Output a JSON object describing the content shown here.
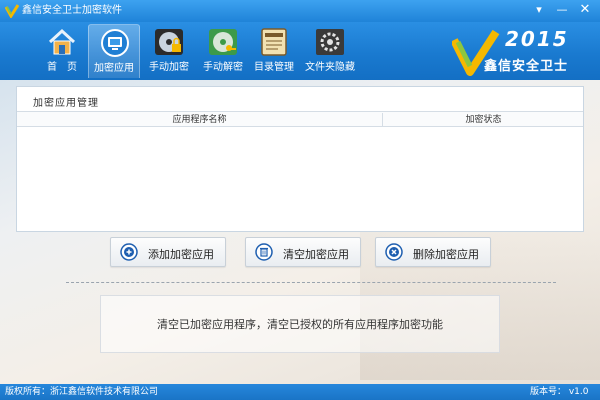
{
  "window": {
    "title": "鑫信安全卫士加密软件",
    "menu_glyph": "▾",
    "min_glyph": "—",
    "close_glyph": "✕"
  },
  "toolbar": {
    "items": [
      {
        "label": "首　页",
        "icon": "home-icon"
      },
      {
        "label": "加密应用",
        "icon": "monitor-icon",
        "active": true
      },
      {
        "label": "手动加密",
        "icon": "disc-lock-icon"
      },
      {
        "label": "手动解密",
        "icon": "disc-key-icon"
      },
      {
        "label": "目录管理",
        "icon": "notebook-icon"
      },
      {
        "label": "文件夹隐藏",
        "icon": "folder-gear-icon"
      }
    ]
  },
  "brand": {
    "year": "2015",
    "name": "鑫信安全卫士",
    "logo": "check-v-logo",
    "colors": {
      "green": "#8dc63f",
      "yellow": "#f5b800"
    }
  },
  "panel": {
    "title": "加密应用管理",
    "columns": [
      "应用程序名称",
      "加密状态"
    ],
    "rows": []
  },
  "actions": {
    "add": "添加加密应用",
    "clear": "清空加密应用",
    "delete": "删除加密应用"
  },
  "description": "清空已加密应用程序，清空已授权的所有应用程序加密功能",
  "status": {
    "copyright": "版权所有：浙江鑫信软件技术有限公司",
    "version": "版本号： v1.0"
  },
  "colors": {
    "primary": "#1b7bd0",
    "accent_blue": "#1f5fb0"
  }
}
